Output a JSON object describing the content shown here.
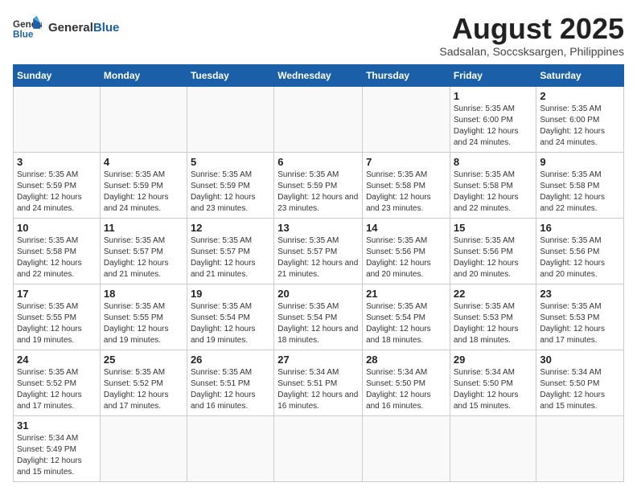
{
  "logo": {
    "text_general": "General",
    "text_blue": "Blue"
  },
  "header": {
    "title": "August 2025",
    "subtitle": "Sadsalan, Soccsksargen, Philippines"
  },
  "weekdays": [
    "Sunday",
    "Monday",
    "Tuesday",
    "Wednesday",
    "Thursday",
    "Friday",
    "Saturday"
  ],
  "weeks": [
    [
      {
        "date": "",
        "info": ""
      },
      {
        "date": "",
        "info": ""
      },
      {
        "date": "",
        "info": ""
      },
      {
        "date": "",
        "info": ""
      },
      {
        "date": "",
        "info": ""
      },
      {
        "date": "1",
        "info": "Sunrise: 5:35 AM\nSunset: 6:00 PM\nDaylight: 12 hours and 24 minutes."
      },
      {
        "date": "2",
        "info": "Sunrise: 5:35 AM\nSunset: 6:00 PM\nDaylight: 12 hours and 24 minutes."
      }
    ],
    [
      {
        "date": "3",
        "info": "Sunrise: 5:35 AM\nSunset: 5:59 PM\nDaylight: 12 hours and 24 minutes."
      },
      {
        "date": "4",
        "info": "Sunrise: 5:35 AM\nSunset: 5:59 PM\nDaylight: 12 hours and 24 minutes."
      },
      {
        "date": "5",
        "info": "Sunrise: 5:35 AM\nSunset: 5:59 PM\nDaylight: 12 hours and 23 minutes."
      },
      {
        "date": "6",
        "info": "Sunrise: 5:35 AM\nSunset: 5:59 PM\nDaylight: 12 hours and 23 minutes."
      },
      {
        "date": "7",
        "info": "Sunrise: 5:35 AM\nSunset: 5:58 PM\nDaylight: 12 hours and 23 minutes."
      },
      {
        "date": "8",
        "info": "Sunrise: 5:35 AM\nSunset: 5:58 PM\nDaylight: 12 hours and 22 minutes."
      },
      {
        "date": "9",
        "info": "Sunrise: 5:35 AM\nSunset: 5:58 PM\nDaylight: 12 hours and 22 minutes."
      }
    ],
    [
      {
        "date": "10",
        "info": "Sunrise: 5:35 AM\nSunset: 5:58 PM\nDaylight: 12 hours and 22 minutes."
      },
      {
        "date": "11",
        "info": "Sunrise: 5:35 AM\nSunset: 5:57 PM\nDaylight: 12 hours and 21 minutes."
      },
      {
        "date": "12",
        "info": "Sunrise: 5:35 AM\nSunset: 5:57 PM\nDaylight: 12 hours and 21 minutes."
      },
      {
        "date": "13",
        "info": "Sunrise: 5:35 AM\nSunset: 5:57 PM\nDaylight: 12 hours and 21 minutes."
      },
      {
        "date": "14",
        "info": "Sunrise: 5:35 AM\nSunset: 5:56 PM\nDaylight: 12 hours and 20 minutes."
      },
      {
        "date": "15",
        "info": "Sunrise: 5:35 AM\nSunset: 5:56 PM\nDaylight: 12 hours and 20 minutes."
      },
      {
        "date": "16",
        "info": "Sunrise: 5:35 AM\nSunset: 5:56 PM\nDaylight: 12 hours and 20 minutes."
      }
    ],
    [
      {
        "date": "17",
        "info": "Sunrise: 5:35 AM\nSunset: 5:55 PM\nDaylight: 12 hours and 19 minutes."
      },
      {
        "date": "18",
        "info": "Sunrise: 5:35 AM\nSunset: 5:55 PM\nDaylight: 12 hours and 19 minutes."
      },
      {
        "date": "19",
        "info": "Sunrise: 5:35 AM\nSunset: 5:54 PM\nDaylight: 12 hours and 19 minutes."
      },
      {
        "date": "20",
        "info": "Sunrise: 5:35 AM\nSunset: 5:54 PM\nDaylight: 12 hours and 18 minutes."
      },
      {
        "date": "21",
        "info": "Sunrise: 5:35 AM\nSunset: 5:54 PM\nDaylight: 12 hours and 18 minutes."
      },
      {
        "date": "22",
        "info": "Sunrise: 5:35 AM\nSunset: 5:53 PM\nDaylight: 12 hours and 18 minutes."
      },
      {
        "date": "23",
        "info": "Sunrise: 5:35 AM\nSunset: 5:53 PM\nDaylight: 12 hours and 17 minutes."
      }
    ],
    [
      {
        "date": "24",
        "info": "Sunrise: 5:35 AM\nSunset: 5:52 PM\nDaylight: 12 hours and 17 minutes."
      },
      {
        "date": "25",
        "info": "Sunrise: 5:35 AM\nSunset: 5:52 PM\nDaylight: 12 hours and 17 minutes."
      },
      {
        "date": "26",
        "info": "Sunrise: 5:35 AM\nSunset: 5:51 PM\nDaylight: 12 hours and 16 minutes."
      },
      {
        "date": "27",
        "info": "Sunrise: 5:34 AM\nSunset: 5:51 PM\nDaylight: 12 hours and 16 minutes."
      },
      {
        "date": "28",
        "info": "Sunrise: 5:34 AM\nSunset: 5:50 PM\nDaylight: 12 hours and 16 minutes."
      },
      {
        "date": "29",
        "info": "Sunrise: 5:34 AM\nSunset: 5:50 PM\nDaylight: 12 hours and 15 minutes."
      },
      {
        "date": "30",
        "info": "Sunrise: 5:34 AM\nSunset: 5:50 PM\nDaylight: 12 hours and 15 minutes."
      }
    ],
    [
      {
        "date": "31",
        "info": "Sunrise: 5:34 AM\nSunset: 5:49 PM\nDaylight: 12 hours and 15 minutes."
      },
      {
        "date": "",
        "info": ""
      },
      {
        "date": "",
        "info": ""
      },
      {
        "date": "",
        "info": ""
      },
      {
        "date": "",
        "info": ""
      },
      {
        "date": "",
        "info": ""
      },
      {
        "date": "",
        "info": ""
      }
    ]
  ]
}
